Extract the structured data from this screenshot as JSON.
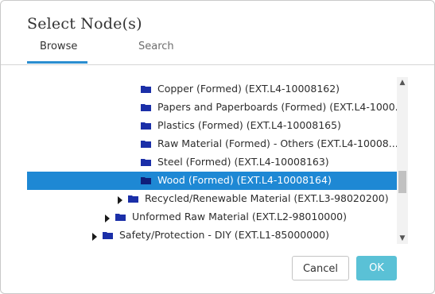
{
  "dialog": {
    "title": "Select Node(s)",
    "tabs": [
      {
        "label": "Browse",
        "active": true
      },
      {
        "label": "Search",
        "active": false
      }
    ],
    "accent_color": "#2b8ed0",
    "selected_color": "#1e88d4"
  },
  "tree": {
    "rows": [
      {
        "label": "Copper (Formed) (EXT.L4-10008162)",
        "selected": false,
        "expandable": false
      },
      {
        "label": "Papers and Paperboards (Formed) (EXT.L4-1000...",
        "selected": false,
        "expandable": false
      },
      {
        "label": "Plastics (Formed) (EXT.L4-10008165)",
        "selected": false,
        "expandable": false
      },
      {
        "label": "Raw Material (Formed) - Others (EXT.L4-10008...",
        "selected": false,
        "expandable": false
      },
      {
        "label": "Steel (Formed) (EXT.L4-10008163)",
        "selected": false,
        "expandable": false
      },
      {
        "label": "Wood (Formed) (EXT.L4-10008164)",
        "selected": true,
        "expandable": false
      },
      {
        "label": "Recycled/Renewable Material (EXT.L3-98020200)",
        "selected": false,
        "expandable": true
      },
      {
        "label": "Unformed Raw Material (EXT.L2-98010000)",
        "selected": false,
        "expandable": true
      },
      {
        "label": "Safety/Protection - DIY (EXT.L1-85000000)",
        "selected": false,
        "expandable": true
      }
    ]
  },
  "buttons": {
    "cancel": "Cancel",
    "ok": "OK"
  }
}
